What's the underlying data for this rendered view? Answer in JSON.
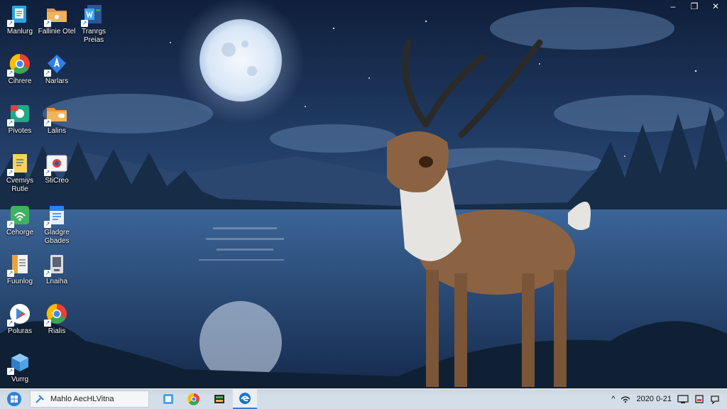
{
  "window_controls": {
    "minimize": "–",
    "restore": "❐",
    "close": "✕"
  },
  "desktop_icons": [
    {
      "label": "Manlurg",
      "icon": "files-icon"
    },
    {
      "label": "Cihrere",
      "icon": "chrome-icon"
    },
    {
      "label": "Pivotes",
      "icon": "app-icon"
    },
    {
      "label": "Cvemiys Rutle",
      "icon": "document-icon"
    },
    {
      "label": "Cehorge",
      "icon": "network-icon"
    },
    {
      "label": "Fuunlog",
      "icon": "notepad-icon"
    },
    {
      "label": "Poluras",
      "icon": "play-store-icon"
    },
    {
      "label": "Vurrg",
      "icon": "cube-icon"
    },
    {
      "label": "Fallinie Otel",
      "icon": "folder-icon"
    },
    {
      "label": "Narlars",
      "icon": "store-icon"
    },
    {
      "label": "Lalins",
      "icon": "folder-icon"
    },
    {
      "label": "StiCreo",
      "icon": "photo-icon"
    },
    {
      "label": "Gladgre Gbades",
      "icon": "doc-icon"
    },
    {
      "label": "Lnaiha",
      "icon": "device-icon"
    },
    {
      "label": "Rialis",
      "icon": "chrome-icon"
    },
    {
      "label": "Tranrgs Preias",
      "icon": "word-icon"
    }
  ],
  "taskbar": {
    "search_text": "Mahlo AecHLVitna",
    "apps": [
      "task-icon",
      "chrome-icon",
      "explorer-icon",
      "edge-icon"
    ],
    "tray": {
      "chevron": "^",
      "clock": "2020 0-21"
    }
  }
}
